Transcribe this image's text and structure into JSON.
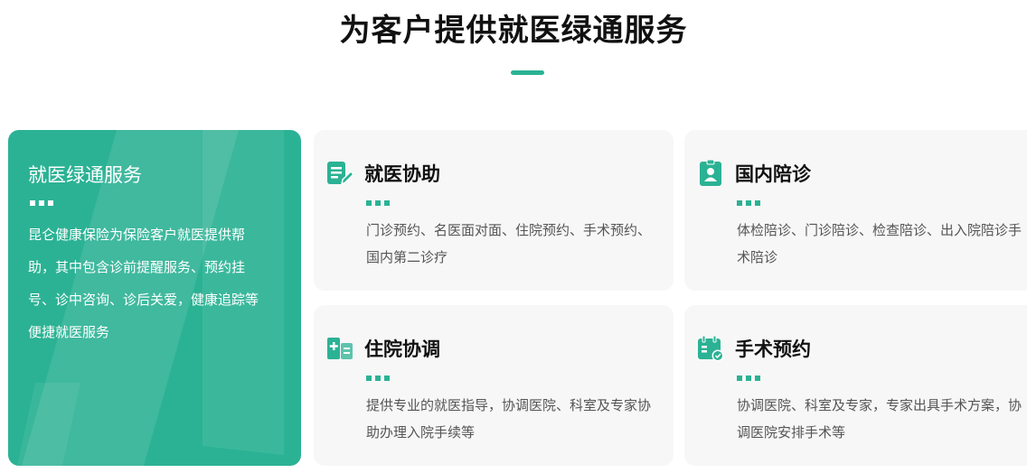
{
  "heading": "为客户提供就医绿通服务",
  "intro": {
    "title": "就医绿通服务",
    "description": "昆仑健康保险为保险客户就医提供帮助，其中包含诊前提醒服务、预约挂号、诊中咨询、诊后关爱，健康追踪等便捷就医服务"
  },
  "services": [
    {
      "icon": "document-edit-icon",
      "title": "就医协助",
      "description": "门诊预约、名医面对面、住院预约、手术预约、国内第二诊疗"
    },
    {
      "icon": "person-badge-icon",
      "title": "国内陪诊",
      "description": "体检陪诊、门诊陪诊、检查陪诊、出入院陪诊手术陪诊"
    },
    {
      "icon": "hospital-admission-icon",
      "title": "住院协调",
      "description": "提供专业的就医指导，协调医院、科室及专家协助办理入院手续等"
    },
    {
      "icon": "calendar-check-icon",
      "title": "手术预约",
      "description": "协调医院、科室及专家，专家出具手术方案，协调医院安排手术等"
    }
  ],
  "colors": {
    "accent": "#2bb294",
    "card_background": "#f7f7f7",
    "text_dark": "#111111",
    "text_muted": "#555555"
  }
}
